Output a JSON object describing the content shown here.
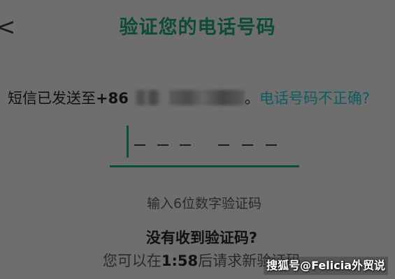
{
  "header": {
    "back_glyph": "<",
    "title": "验证您的电话号码"
  },
  "sms_notice": {
    "prefix": "短信已发送至",
    "country_code": "+86",
    "suffix": "。",
    "wrong_number_link": "电话号码不正确?"
  },
  "code_input": {
    "digits": 6,
    "hint": "输入6位数字验证码"
  },
  "resend": {
    "heading": "没有收到验证码?",
    "prefix": "您可以在",
    "countdown": "1:58",
    "suffix": "后请求新验证码"
  },
  "watermark": {
    "text": "搜狐号@Felicia外贸说"
  },
  "colors": {
    "accent": "#0e4f3c",
    "link": "#0f5c62",
    "overlay_background": "#6e6e6e"
  },
  "icons": {
    "back": "chevron-left-icon"
  }
}
